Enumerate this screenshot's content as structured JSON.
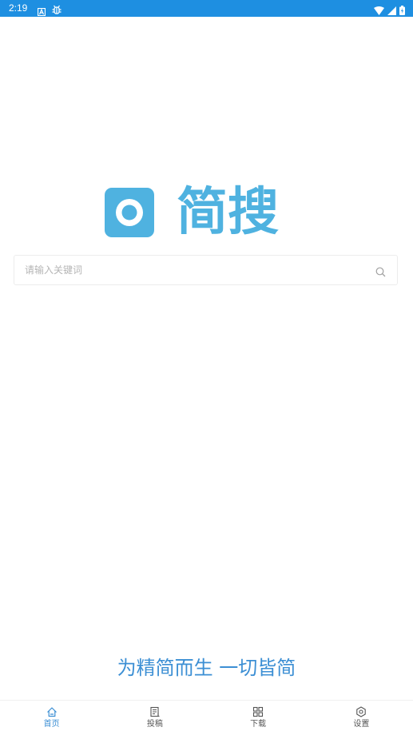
{
  "status_bar": {
    "time": "2:19"
  },
  "logo": {
    "text": "简搜"
  },
  "search": {
    "placeholder": "请输入关键词"
  },
  "slogan": "为精简而生 一切皆简",
  "nav": {
    "items": [
      {
        "label": "首页",
        "icon": "home-icon",
        "active": true
      },
      {
        "label": "投稿",
        "icon": "submit-icon",
        "active": false
      },
      {
        "label": "下载",
        "icon": "download-grid-icon",
        "active": false
      },
      {
        "label": "设置",
        "icon": "settings-gear-icon",
        "active": false
      }
    ]
  },
  "colors": {
    "status_bar": "#1e8fe1",
    "logo": "#4fb2e0",
    "slogan": "#3c8fd4",
    "nav_active": "#3c8fd4",
    "nav_inactive": "#555555"
  }
}
